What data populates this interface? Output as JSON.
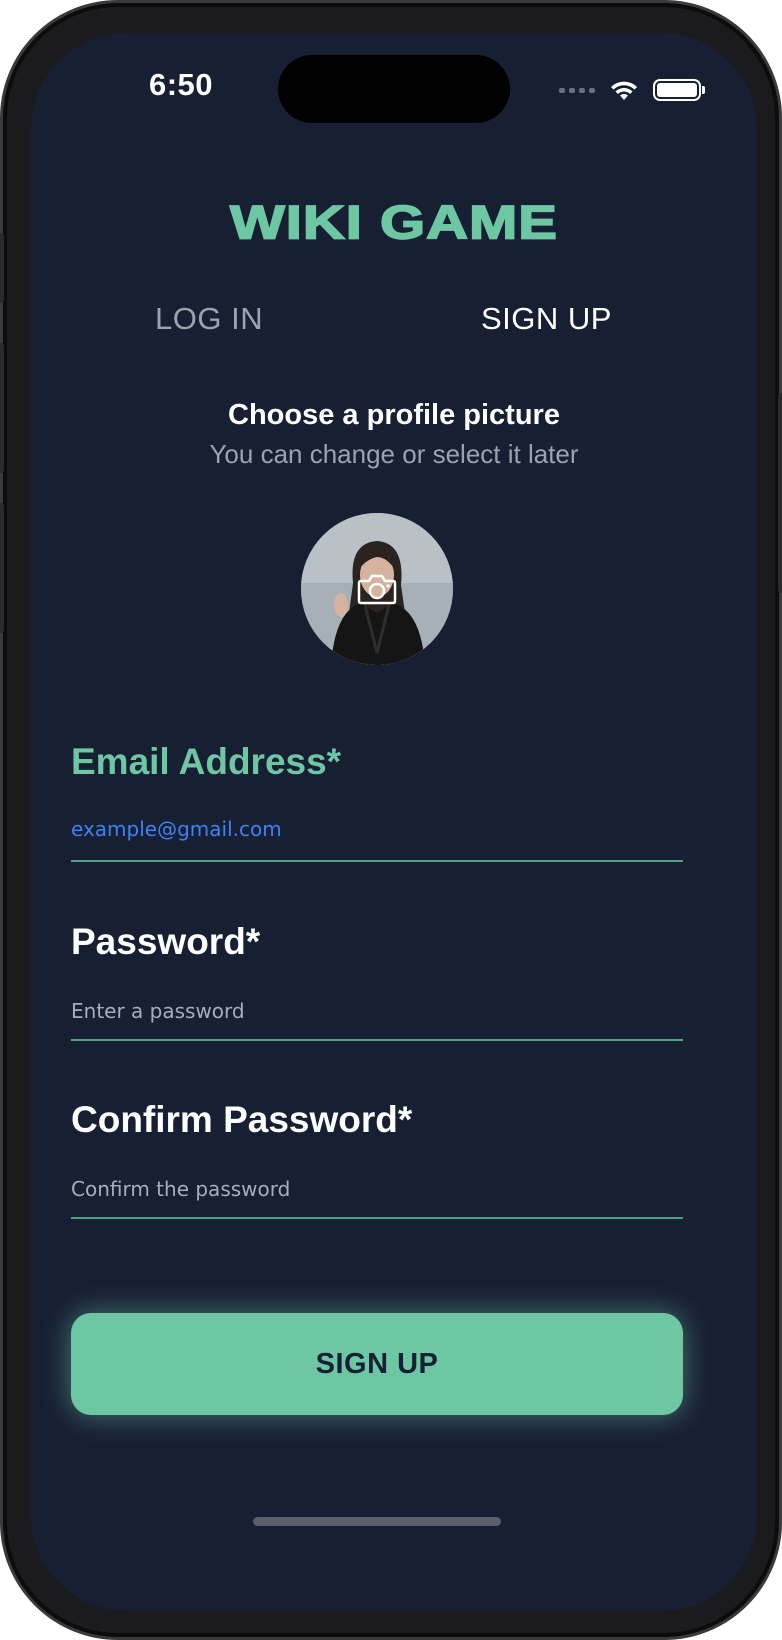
{
  "status_bar": {
    "time": "6:50"
  },
  "app": {
    "title": "WIKI GAME"
  },
  "tabs": [
    {
      "label": "LOG IN",
      "active": false
    },
    {
      "label": "SIGN UP",
      "active": true
    }
  ],
  "profile": {
    "heading": "Choose a profile picture",
    "subheading": "You can change or select it later"
  },
  "form": {
    "email": {
      "label": "Email Address*",
      "value": "example@gmail.com"
    },
    "password": {
      "label": "Password*",
      "placeholder": "Enter a password"
    },
    "confirm_password": {
      "label": "Confirm Password*",
      "placeholder": "Confirm the password"
    }
  },
  "actions": {
    "signup_label": "SIGN UP"
  },
  "colors": {
    "background": "#171f33",
    "accent": "#6ec7a3",
    "link": "#3b82f6",
    "muted": "#9ea2ad"
  },
  "icons": [
    "wifi-icon",
    "battery-icon",
    "camera-icon",
    "signal-icon"
  ]
}
